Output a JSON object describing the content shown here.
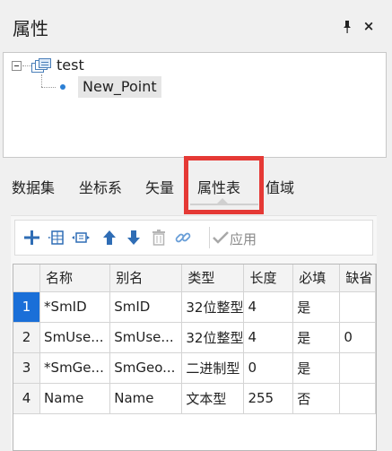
{
  "panel": {
    "title": "属性",
    "pin_glyph": "📌",
    "close_glyph": "×"
  },
  "tree": {
    "root_label": "test",
    "child_label": "New_Point",
    "root_icon": "dataset-icon",
    "child_icon": "point-icon"
  },
  "tabs": [
    "数据集",
    "坐标系",
    "矢量",
    "属性表",
    "值域"
  ],
  "active_tab": "属性表",
  "highlight_color": "#e53935",
  "toolbar": {
    "apply_label": "应用",
    "icons": [
      "add-icon",
      "insert-field-icon",
      "edit-field-icon",
      "arrow-up-icon",
      "arrow-down-icon",
      "delete-icon",
      "link-icon",
      "apply-check-icon"
    ]
  },
  "table": {
    "columns": [
      "",
      "名称",
      "别名",
      "类型",
      "长度",
      "必填",
      "缺省"
    ],
    "rows": [
      [
        "1",
        "*SmID",
        "SmID",
        "32位整型",
        "4",
        "是",
        ""
      ],
      [
        "2",
        "SmUse...",
        "SmUse...",
        "32位整型",
        "4",
        "是",
        "0"
      ],
      [
        "3",
        "*SmGe...",
        "SmGeo...",
        "二进制型",
        "0",
        "是",
        ""
      ],
      [
        "4",
        "Name",
        "Name",
        "文本型",
        "255",
        "否",
        ""
      ]
    ],
    "selected_row": "1",
    "selection_color": "#1a6fd8"
  }
}
